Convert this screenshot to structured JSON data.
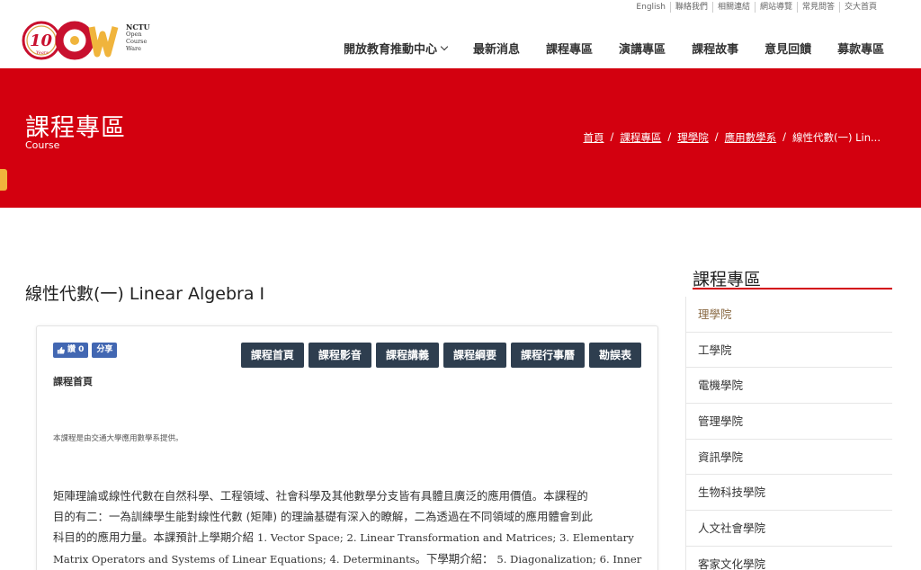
{
  "utility_links": [
    "English",
    "聯絡我們",
    "相關連結",
    "網站導覽",
    "常見問答",
    "交大首頁"
  ],
  "logo": {
    "badge": "10",
    "years": "Years",
    "line1": "NCTU",
    "line2": "Open",
    "line3": "Course",
    "line4": "Ware"
  },
  "nav": {
    "items": [
      "開放教育推動中心",
      "最新消息",
      "課程專區",
      "演講專區",
      "課程故事",
      "意見回饋",
      "募款專區"
    ]
  },
  "banner": {
    "title": "課程專區",
    "subtitle": "Course",
    "breadcrumb": [
      "首頁",
      "課程專區",
      "理學院",
      "應用數學系",
      "線性代數(一) Lin..."
    ]
  },
  "page_title": "線性代數(一) Linear Algebra I",
  "facebook": {
    "like_label": "讚 0",
    "share_label": "分享"
  },
  "course_buttons": [
    "課程首頁",
    "課程影音",
    "課程講義",
    "課程綱要",
    "課程行事曆",
    "勘誤表"
  ],
  "section_title": "課程首頁",
  "provider_note": "本課程是由交通大學應用數學系提供。",
  "description": {
    "line1": "矩陣理論或線性代數在自然科學、工程領域、社會科學及其他數學分支皆有具體且廣泛的應用價值。本課程的",
    "line2": "目的有二：一為訓練學生能對線性代數 (矩陣) 的理論基礎有深入的瞭解，二為透過在不同領域的應用體會到此",
    "line3_zh": "科目的的應用力量。本課預計上學期介紹 ",
    "line3_en": "1. Vector Space; 2. Linear Transformation and Matrices; 3. Elementary",
    "line4_en": "Matrix Operators and Systems of Linear Equations; 4. Determinants",
    "line4_zh": "。下學期介紹： ",
    "line4_en2": " 5. Diagonalization; 6. Inner"
  },
  "sidebar": {
    "title": "課程專區",
    "items": [
      "理學院",
      "工學院",
      "電機學院",
      "管理學院",
      "資訊學院",
      "生物科技學院",
      "人文社會學院",
      "客家文化學院"
    ]
  },
  "colors": {
    "brand_red": "#d3000f",
    "button_navy": "#2e3e4f",
    "facebook_blue": "#4267b2",
    "accent_gold": "#f0b43c"
  }
}
